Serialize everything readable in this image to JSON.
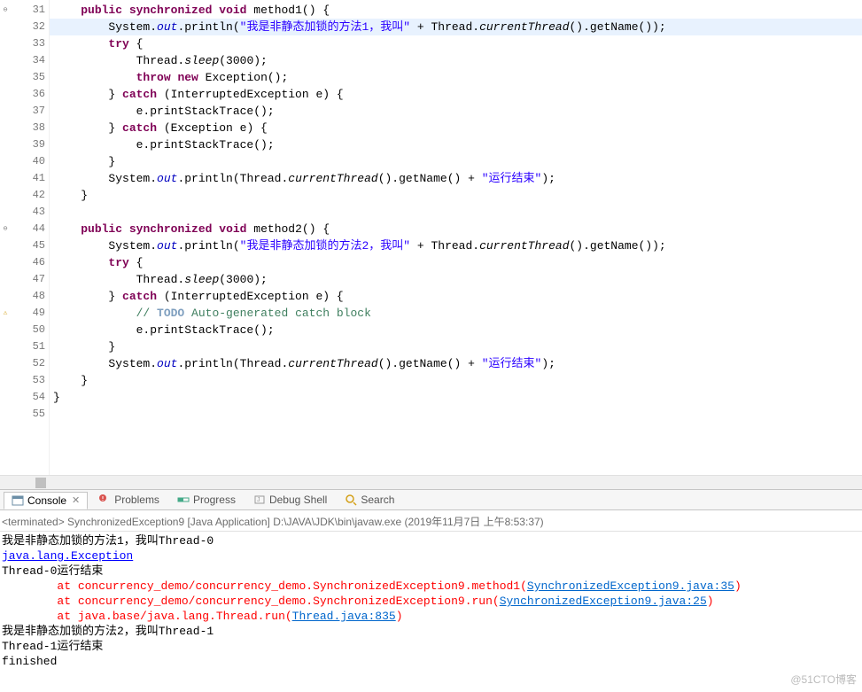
{
  "code": {
    "lines": [
      {
        "n": "31",
        "marker": "⊖",
        "hl": false,
        "parts": [
          {
            "t": "    "
          },
          {
            "t": "public",
            "c": "kw"
          },
          {
            "t": " "
          },
          {
            "t": "synchronized",
            "c": "kw"
          },
          {
            "t": " "
          },
          {
            "t": "void",
            "c": "kw"
          },
          {
            "t": " method1() {"
          }
        ]
      },
      {
        "n": "32",
        "marker": "",
        "hl": true,
        "parts": [
          {
            "t": "        System."
          },
          {
            "t": "out",
            "c": "field"
          },
          {
            "t": ".println("
          },
          {
            "t": "\"我是非静态加锁的方法1，我叫\"",
            "c": "str"
          },
          {
            "t": " + Thread."
          },
          {
            "t": "currentThread",
            "c": "method-static"
          },
          {
            "t": "().getName());"
          }
        ]
      },
      {
        "n": "33",
        "marker": "",
        "hl": false,
        "parts": [
          {
            "t": "        "
          },
          {
            "t": "try",
            "c": "kw"
          },
          {
            "t": " {"
          }
        ]
      },
      {
        "n": "34",
        "marker": "",
        "hl": false,
        "parts": [
          {
            "t": "            Thread."
          },
          {
            "t": "sleep",
            "c": "method-static"
          },
          {
            "t": "(3000);"
          }
        ]
      },
      {
        "n": "35",
        "marker": "",
        "hl": false,
        "parts": [
          {
            "t": "            "
          },
          {
            "t": "throw",
            "c": "kw"
          },
          {
            "t": " "
          },
          {
            "t": "new",
            "c": "kw"
          },
          {
            "t": " Exception();"
          }
        ]
      },
      {
        "n": "36",
        "marker": "",
        "hl": false,
        "parts": [
          {
            "t": "        } "
          },
          {
            "t": "catch",
            "c": "kw"
          },
          {
            "t": " (InterruptedException e) {"
          }
        ]
      },
      {
        "n": "37",
        "marker": "",
        "hl": false,
        "parts": [
          {
            "t": "            e.printStackTrace();"
          }
        ]
      },
      {
        "n": "38",
        "marker": "",
        "hl": false,
        "parts": [
          {
            "t": "        } "
          },
          {
            "t": "catch",
            "c": "kw"
          },
          {
            "t": " (Exception e) {"
          }
        ]
      },
      {
        "n": "39",
        "marker": "",
        "hl": false,
        "parts": [
          {
            "t": "            e.printStackTrace();"
          }
        ]
      },
      {
        "n": "40",
        "marker": "",
        "hl": false,
        "parts": [
          {
            "t": "        }"
          }
        ]
      },
      {
        "n": "41",
        "marker": "",
        "hl": false,
        "parts": [
          {
            "t": "        System."
          },
          {
            "t": "out",
            "c": "field"
          },
          {
            "t": ".println(Thread."
          },
          {
            "t": "currentThread",
            "c": "method-static"
          },
          {
            "t": "().getName() + "
          },
          {
            "t": "\"运行结束\"",
            "c": "str"
          },
          {
            "t": ");"
          }
        ]
      },
      {
        "n": "42",
        "marker": "",
        "hl": false,
        "parts": [
          {
            "t": "    }"
          }
        ]
      },
      {
        "n": "43",
        "marker": "",
        "hl": false,
        "parts": [
          {
            "t": ""
          }
        ]
      },
      {
        "n": "44",
        "marker": "⊖",
        "hl": false,
        "parts": [
          {
            "t": "    "
          },
          {
            "t": "public",
            "c": "kw"
          },
          {
            "t": " "
          },
          {
            "t": "synchronized",
            "c": "kw"
          },
          {
            "t": " "
          },
          {
            "t": "void",
            "c": "kw"
          },
          {
            "t": " method2() {"
          }
        ]
      },
      {
        "n": "45",
        "marker": "",
        "hl": false,
        "parts": [
          {
            "t": "        System."
          },
          {
            "t": "out",
            "c": "field"
          },
          {
            "t": ".println("
          },
          {
            "t": "\"我是非静态加锁的方法2，我叫\"",
            "c": "str"
          },
          {
            "t": " + Thread."
          },
          {
            "t": "currentThread",
            "c": "method-static"
          },
          {
            "t": "().getName());"
          }
        ]
      },
      {
        "n": "46",
        "marker": "",
        "hl": false,
        "parts": [
          {
            "t": "        "
          },
          {
            "t": "try",
            "c": "kw"
          },
          {
            "t": " {"
          }
        ]
      },
      {
        "n": "47",
        "marker": "",
        "hl": false,
        "parts": [
          {
            "t": "            Thread."
          },
          {
            "t": "sleep",
            "c": "method-static"
          },
          {
            "t": "(3000);"
          }
        ]
      },
      {
        "n": "48",
        "marker": "",
        "hl": false,
        "parts": [
          {
            "t": "        } "
          },
          {
            "t": "catch",
            "c": "kw"
          },
          {
            "t": " (InterruptedException e) {"
          }
        ]
      },
      {
        "n": "49",
        "marker": "💡",
        "hl": false,
        "parts": [
          {
            "t": "            "
          },
          {
            "t": "// ",
            "c": "comment-todo"
          },
          {
            "t": "TODO",
            "c": "comment-todo-tag"
          },
          {
            "t": " Auto-generated catch block",
            "c": "comment-todo"
          }
        ]
      },
      {
        "n": "50",
        "marker": "",
        "hl": false,
        "parts": [
          {
            "t": "            e.printStackTrace();"
          }
        ]
      },
      {
        "n": "51",
        "marker": "",
        "hl": false,
        "parts": [
          {
            "t": "        }"
          }
        ]
      },
      {
        "n": "52",
        "marker": "",
        "hl": false,
        "parts": [
          {
            "t": "        System."
          },
          {
            "t": "out",
            "c": "field"
          },
          {
            "t": ".println(Thread."
          },
          {
            "t": "currentThread",
            "c": "method-static"
          },
          {
            "t": "().getName() + "
          },
          {
            "t": "\"运行结束\"",
            "c": "str"
          },
          {
            "t": ");"
          }
        ]
      },
      {
        "n": "53",
        "marker": "",
        "hl": false,
        "parts": [
          {
            "t": "    }"
          }
        ]
      },
      {
        "n": "54",
        "marker": "",
        "hl": false,
        "parts": [
          {
            "t": "}"
          }
        ]
      },
      {
        "n": "55",
        "marker": "",
        "hl": false,
        "parts": [
          {
            "t": ""
          }
        ]
      }
    ]
  },
  "tabs": {
    "console": {
      "label": "Console",
      "icon": "console-icon"
    },
    "problems": {
      "label": "Problems",
      "icon": "problems-icon"
    },
    "progress": {
      "label": "Progress",
      "icon": "progress-icon"
    },
    "debugshell": {
      "label": "Debug Shell",
      "icon": "debugshell-icon"
    },
    "search": {
      "label": "Search",
      "icon": "search-icon"
    }
  },
  "console": {
    "header": "<terminated> SynchronizedException9 [Java Application] D:\\JAVA\\JDK\\bin\\javaw.exe (2019年11月7日 上午8:53:37)",
    "lines": [
      {
        "parts": [
          {
            "t": "我是非静态加锁的方法1，我叫Thread-0"
          }
        ]
      },
      {
        "parts": [
          {
            "t": "java.lang.Exception",
            "c": "err link"
          }
        ]
      },
      {
        "parts": [
          {
            "t": "Thread-0运行结束"
          }
        ]
      },
      {
        "parts": [
          {
            "t": "\tat concurrency_demo/concurrency_demo.SynchronizedException9.method1(",
            "c": "err"
          },
          {
            "t": "SynchronizedException9.java:35",
            "c": "err-link"
          },
          {
            "t": ")",
            "c": "err"
          }
        ]
      },
      {
        "parts": [
          {
            "t": "\tat concurrency_demo/concurrency_demo.SynchronizedException9.run(",
            "c": "err"
          },
          {
            "t": "SynchronizedException9.java:25",
            "c": "err-link"
          },
          {
            "t": ")",
            "c": "err"
          }
        ]
      },
      {
        "parts": [
          {
            "t": "\tat java.base/java.lang.Thread.run(",
            "c": "err"
          },
          {
            "t": "Thread.java:835",
            "c": "err-link"
          },
          {
            "t": ")",
            "c": "err"
          }
        ]
      },
      {
        "parts": [
          {
            "t": "我是非静态加锁的方法2，我叫Thread-1"
          }
        ]
      },
      {
        "parts": [
          {
            "t": "Thread-1运行结束"
          }
        ]
      },
      {
        "parts": [
          {
            "t": "finished"
          }
        ]
      }
    ]
  },
  "watermark": "@51CTO博客"
}
